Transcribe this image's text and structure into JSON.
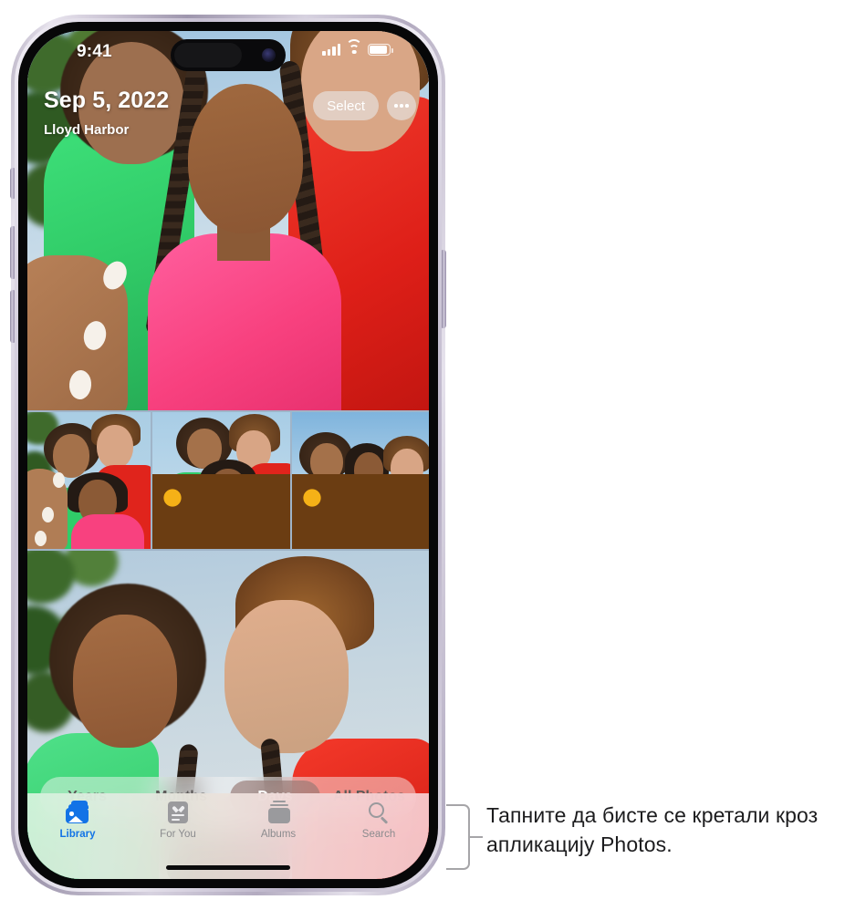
{
  "status_bar": {
    "time": "9:41",
    "cellular_icon": "cellular-signal-icon",
    "wifi_icon": "wifi-icon",
    "battery_icon": "battery-icon"
  },
  "hero": {
    "date": "Sep 5, 2022",
    "location": "Lloyd Harbor",
    "select_label": "Select",
    "more_icon": "ellipsis-icon"
  },
  "segmented_control": {
    "options": [
      {
        "label": "Years",
        "active": false
      },
      {
        "label": "Months",
        "active": false
      },
      {
        "label": "Days",
        "active": true
      },
      {
        "label": "All Photos",
        "active": false
      }
    ],
    "selected": "Days",
    "selected_bg": "#96787366",
    "selected_text_color": "#ffffff"
  },
  "tab_bar": {
    "tabs": [
      {
        "label": "Library",
        "icon": "photo-stack-icon",
        "active": true
      },
      {
        "label": "For You",
        "icon": "for-you-card-icon",
        "active": false
      },
      {
        "label": "Albums",
        "icon": "albums-stack-icon",
        "active": false
      },
      {
        "label": "Search",
        "icon": "magnifier-icon",
        "active": false
      }
    ],
    "active_color": "#1273e6",
    "inactive_color": "#8b8b8e"
  },
  "callout": {
    "text": "Тапните да бисте се кретали кроз апликацију Photos.",
    "bracket_color": "#a6a5a8"
  },
  "device": {
    "frame_color": "#c7c0d2",
    "screen_bg": "#9fb4c8"
  }
}
